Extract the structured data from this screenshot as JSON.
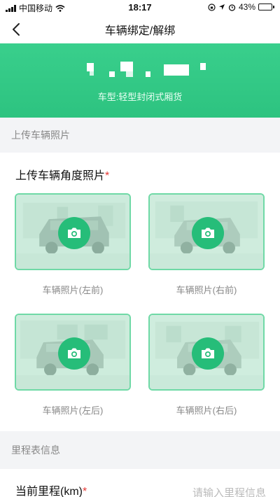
{
  "status_bar": {
    "carrier": "中国移动",
    "time": "18:17",
    "battery": "43%",
    "battery_level": 0.43
  },
  "nav": {
    "title": "车辆绑定/解绑",
    "back_icon": "chevron-left-icon"
  },
  "vehicle": {
    "type_label": "车型:轻型封闭式厢货"
  },
  "photo_section": {
    "header": "上传车辆照片",
    "subtitle": "上传车辆角度照片",
    "required_mark": "*",
    "photos": [
      {
        "caption": "车辆照片(左前)",
        "icon": "camera-icon"
      },
      {
        "caption": "车辆照片(右前)",
        "icon": "camera-icon"
      },
      {
        "caption": "车辆照片(左后)",
        "icon": "camera-icon"
      },
      {
        "caption": "车辆照片(右后)",
        "icon": "camera-icon"
      }
    ]
  },
  "odometer_section": {
    "header": "里程表信息",
    "label": "当前里程(km)",
    "required_mark": "*",
    "placeholder": "请输入里程信息"
  },
  "colors": {
    "accent": "#2dc380",
    "camera_button": "#26bd79",
    "tile_border": "#6fd9a6",
    "required": "#e53935"
  }
}
